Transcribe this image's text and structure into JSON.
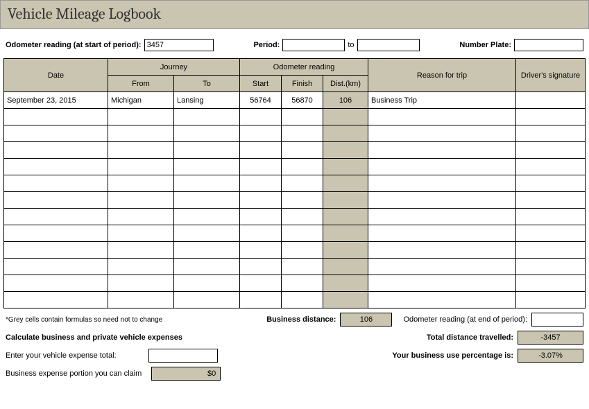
{
  "title": "Vehicle Mileage Logbook",
  "labels": {
    "odometerStart": "Odometer reading (at start of period):",
    "period": "Period:",
    "to": "to",
    "numberPlate": "Number Plate:"
  },
  "values": {
    "odometerStart": "3457",
    "periodFrom": "",
    "periodTo": "",
    "numberPlate": ""
  },
  "headers": {
    "date": "Date",
    "journey": "Journey",
    "from": "From",
    "to": "To",
    "odometer": "Odometer reading",
    "start": "Start",
    "finish": "Finish",
    "dist": "Dist.(km)",
    "reason": "Reason for trip",
    "signature": "Driver's signature"
  },
  "rows": [
    {
      "date": "September 23, 2015",
      "from": "Michigan",
      "to": "Lansing",
      "start": "56764",
      "finish": "56870",
      "dist": "106",
      "reason": "Business Trip",
      "sig": ""
    },
    {
      "date": "",
      "from": "",
      "to": "",
      "start": "",
      "finish": "",
      "dist": "",
      "reason": "",
      "sig": ""
    },
    {
      "date": "",
      "from": "",
      "to": "",
      "start": "",
      "finish": "",
      "dist": "",
      "reason": "",
      "sig": ""
    },
    {
      "date": "",
      "from": "",
      "to": "",
      "start": "",
      "finish": "",
      "dist": "",
      "reason": "",
      "sig": ""
    },
    {
      "date": "",
      "from": "",
      "to": "",
      "start": "",
      "finish": "",
      "dist": "",
      "reason": "",
      "sig": ""
    },
    {
      "date": "",
      "from": "",
      "to": "",
      "start": "",
      "finish": "",
      "dist": "",
      "reason": "",
      "sig": ""
    },
    {
      "date": "",
      "from": "",
      "to": "",
      "start": "",
      "finish": "",
      "dist": "",
      "reason": "",
      "sig": ""
    },
    {
      "date": "",
      "from": "",
      "to": "",
      "start": "",
      "finish": "",
      "dist": "",
      "reason": "",
      "sig": ""
    },
    {
      "date": "",
      "from": "",
      "to": "",
      "start": "",
      "finish": "",
      "dist": "",
      "reason": "",
      "sig": ""
    },
    {
      "date": "",
      "from": "",
      "to": "",
      "start": "",
      "finish": "",
      "dist": "",
      "reason": "",
      "sig": ""
    },
    {
      "date": "",
      "from": "",
      "to": "",
      "start": "",
      "finish": "",
      "dist": "",
      "reason": "",
      "sig": ""
    },
    {
      "date": "",
      "from": "",
      "to": "",
      "start": "",
      "finish": "",
      "dist": "",
      "reason": "",
      "sig": ""
    },
    {
      "date": "",
      "from": "",
      "to": "",
      "start": "",
      "finish": "",
      "dist": "",
      "reason": "",
      "sig": ""
    }
  ],
  "footer": {
    "note": "*Grey cells contain formulas so need not to change",
    "businessDistanceLabel": "Business distance:",
    "businessDistance": "106",
    "odometerEndLabel": "Odometer reading (at end of period):",
    "odometerEnd": "",
    "calcHeader": "Calculate business and private vehicle expenses",
    "totalDistanceLabel": "Total distance travelled:",
    "totalDistance": "-3457",
    "expenseTotalLabel": "Enter your vehicle expense total:",
    "expenseTotal": "",
    "percentageLabel": "Your business use percentage is:",
    "percentage": "-3.07%",
    "claimLabel": "Business expense portion you can claim",
    "claim": "$0"
  }
}
